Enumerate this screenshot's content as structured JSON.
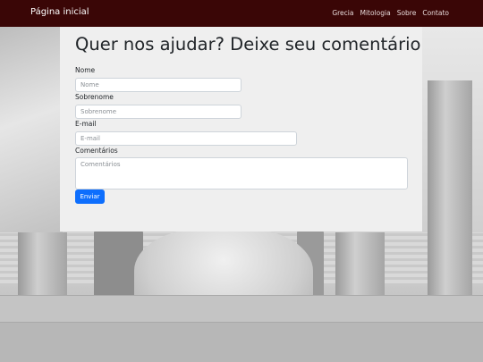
{
  "navbar": {
    "brand": "Página inicial",
    "links": [
      "Grecia",
      "Mitologia",
      "Sobre",
      "Contato"
    ]
  },
  "form": {
    "title": "Quer nos ajudar? Deixe seu comentário",
    "fields": [
      {
        "label": "Nome",
        "placeholder": "Nome",
        "value": ""
      },
      {
        "label": "Sobrenome",
        "placeholder": "Sobrenome",
        "value": ""
      },
      {
        "label": "E-mail",
        "placeholder": "E-mail",
        "value": ""
      },
      {
        "label": "Comentários",
        "placeholder": "Comentários",
        "value": ""
      }
    ],
    "submit_label": "Enviar"
  },
  "colors": {
    "navbar_bg": "#3a0606",
    "button_bg": "#0d6efd",
    "card_bg": "#efefef"
  }
}
